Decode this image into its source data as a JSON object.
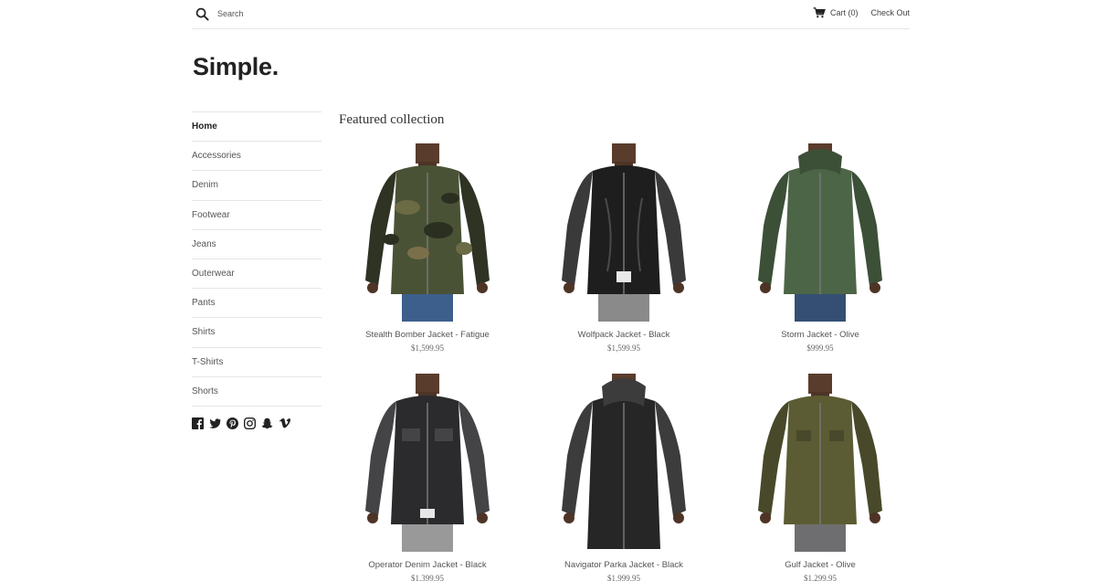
{
  "header": {
    "search_placeholder": "Search",
    "cart_label": "Cart (0)",
    "checkout_label": "Check Out"
  },
  "store": {
    "logo": "Simple."
  },
  "sidebar": {
    "items": [
      {
        "label": "Home",
        "active": true
      },
      {
        "label": "Accessories"
      },
      {
        "label": "Denim"
      },
      {
        "label": "Footwear"
      },
      {
        "label": "Jeans"
      },
      {
        "label": "Outerwear"
      },
      {
        "label": "Pants"
      },
      {
        "label": "Shirts"
      },
      {
        "label": "T-Shirts"
      },
      {
        "label": "Shorts"
      }
    ],
    "social": [
      "facebook-icon",
      "twitter-icon",
      "pinterest-icon",
      "instagram-icon",
      "snapchat-icon",
      "vimeo-icon"
    ]
  },
  "main": {
    "title": "Featured collection",
    "products": [
      {
        "name": "Stealth Bomber Jacket - Fatigue",
        "price": "$1,599.95",
        "jacket": "#4a5236",
        "accent": "#2e3323",
        "pants": "#3d5f8c",
        "style": "camo"
      },
      {
        "name": "Wolfpack Jacket - Black",
        "price": "$1,599.95",
        "jacket": "#1e1e1e",
        "accent": "#3a3a3a",
        "pants": "#8a8a8a",
        "style": "leather"
      },
      {
        "name": "Storm Jacket - Olive",
        "price": "$999.95",
        "jacket": "#4d6547",
        "accent": "#3b5037",
        "pants": "#344f73",
        "style": "hood"
      },
      {
        "name": "Operator Denim Jacket - Black",
        "price": "$1,399.95",
        "jacket": "#2b2b2d",
        "accent": "#444447",
        "pants": "#999999",
        "style": "denim"
      },
      {
        "name": "Navigator Parka Jacket - Black",
        "price": "$1,999.95",
        "jacket": "#262626",
        "accent": "#3c3c3c",
        "pants": "#7a93b3",
        "style": "parka"
      },
      {
        "name": "Gulf Jacket - Olive",
        "price": "$1,299.95",
        "jacket": "#5b5c33",
        "accent": "#48492a",
        "pants": "#6e6e70",
        "style": "shirt"
      }
    ]
  }
}
